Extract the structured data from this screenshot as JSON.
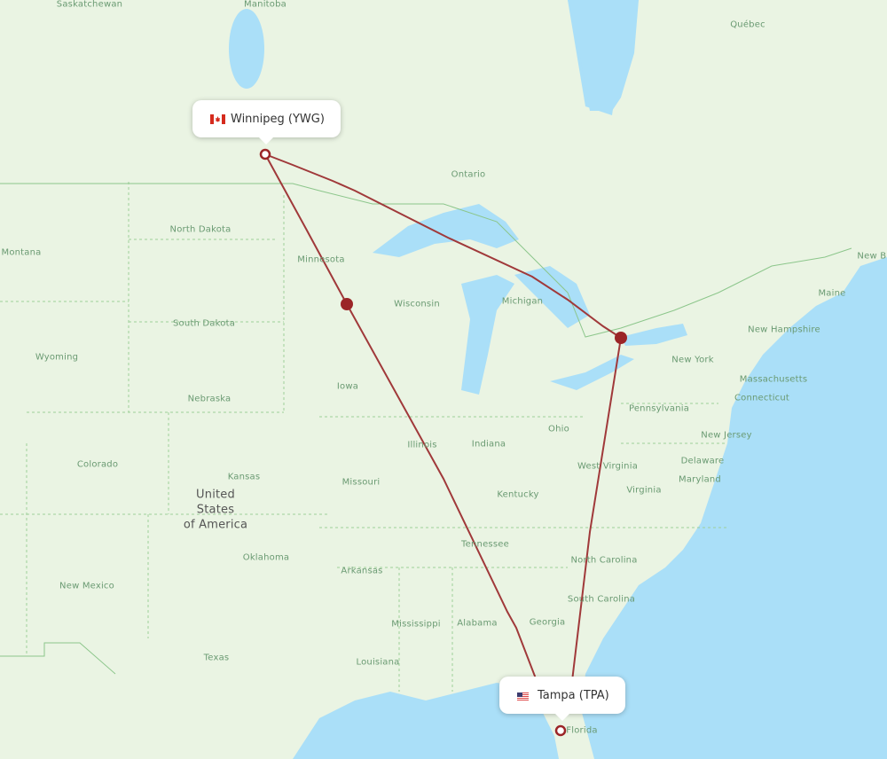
{
  "map": {
    "colors": {
      "water": "#aadff8",
      "land": "#eaf4e3",
      "route": "#a0393a",
      "stop": "#9b2527",
      "label": "#6a9a72"
    },
    "origin": {
      "city": "Winnipeg",
      "code": "YWG",
      "label": "Winnipeg (YWG)",
      "flag": "canada-flag"
    },
    "destination": {
      "city": "Tampa",
      "code": "TPA",
      "label": "Tampa (TPA)",
      "flag": "usa-flag"
    },
    "routes": [
      {
        "name": "via-minnesota",
        "stops": [
          "Winnipeg (YWG)",
          "Minneapolis area stop",
          "Tampa (TPA)"
        ]
      },
      {
        "name": "via-toronto",
        "stops": [
          "Winnipeg (YWG)",
          "Toronto area stop",
          "Tampa (TPA)"
        ]
      }
    ],
    "region_labels": [
      "Saskatchewan",
      "Manitoba",
      "Québec",
      "Ontario",
      "North Dakota",
      "Montana",
      "Minnesota",
      "Wisconsin",
      "Michigan",
      "South Dakota",
      "Wyoming",
      "Maine",
      "New Hampshire",
      "New York",
      "Massachusetts",
      "Connecticut",
      "Iowa",
      "Nebraska",
      "Pennsylvania",
      "Ohio",
      "Illinois",
      "Indiana",
      "New Jersey",
      "Colorado",
      "Kansas",
      "West Virginia",
      "Delaware",
      "Maryland",
      "Missouri",
      "Kentucky",
      "Virginia",
      "Tennessee",
      "North Carolina",
      "Oklahoma",
      "Arkansas",
      "New Mexico",
      "South Carolina",
      "Mississippi",
      "Alabama",
      "Georgia",
      "Texas",
      "Louisiana",
      "Florida",
      "New Br"
    ],
    "country_label": "United\nStates\nof America"
  }
}
